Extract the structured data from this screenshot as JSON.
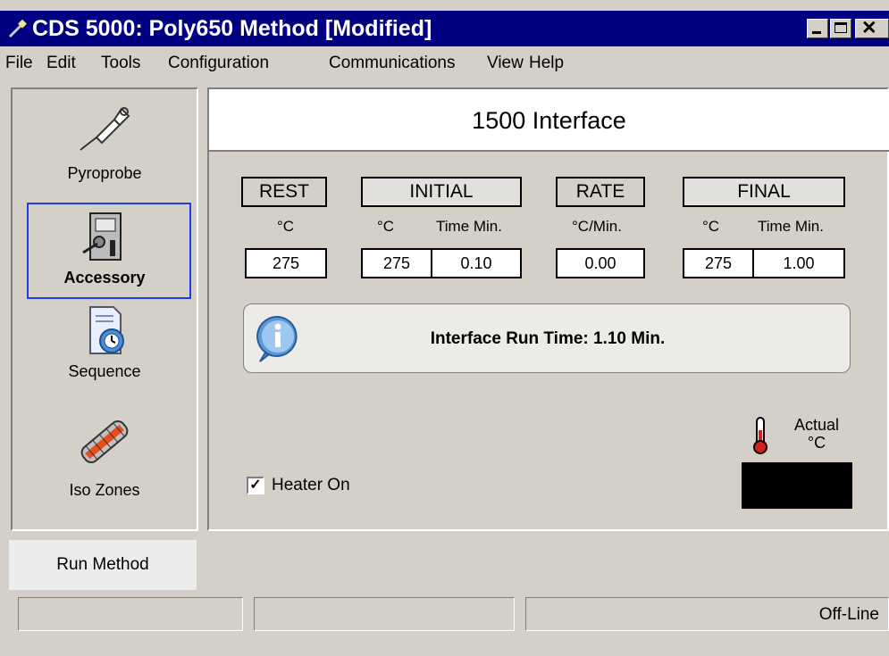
{
  "window": {
    "title": "CDS 5000: Poly650 Method [Modified]",
    "title_icon": "probe-icon",
    "buttons": [
      "minimize",
      "maximize",
      "close"
    ]
  },
  "menu": {
    "file": "File",
    "edit": "Edit",
    "tools": "Tools",
    "configuration": "Configuration",
    "communications": "Communications",
    "view": "View",
    "help": "Help"
  },
  "sidebar": {
    "items": [
      {
        "label": "Pyroprobe",
        "icon": "pyroprobe-icon"
      },
      {
        "label": "Accessory",
        "icon": "accessory-icon",
        "selected": true
      },
      {
        "label": "Sequence",
        "icon": "sequence-icon"
      },
      {
        "label": "Iso Zones",
        "icon": "iso-zones-icon"
      }
    ],
    "selected_color": "#1e3ce6"
  },
  "panel": {
    "title": "1500 Interface",
    "columns": {
      "rest": {
        "header": "REST",
        "unit": "°C",
        "value": "275"
      },
      "initial": {
        "header": "INITIAL",
        "unit": "°C",
        "time_unit": "Time Min.",
        "value": "275",
        "time": "0.10"
      },
      "rate": {
        "header": "RATE",
        "unit": "°C/Min.",
        "value": "0.00"
      },
      "final": {
        "header": "FINAL",
        "unit": "°C",
        "time_unit": "Time Min.",
        "value": "275",
        "time": "1.00"
      }
    },
    "info": {
      "icon": "info-icon",
      "text": "Interface Run Time: 1.10 Min."
    },
    "heater": {
      "label": "Heater On",
      "checked": true
    },
    "actual": {
      "label_line1": "Actual",
      "label_line2": "°C",
      "icon": "thermometer-icon",
      "value": ""
    }
  },
  "run_button": "Run Method",
  "status_bar": {
    "field1": "",
    "field2": "",
    "field3": "Off-Line"
  }
}
